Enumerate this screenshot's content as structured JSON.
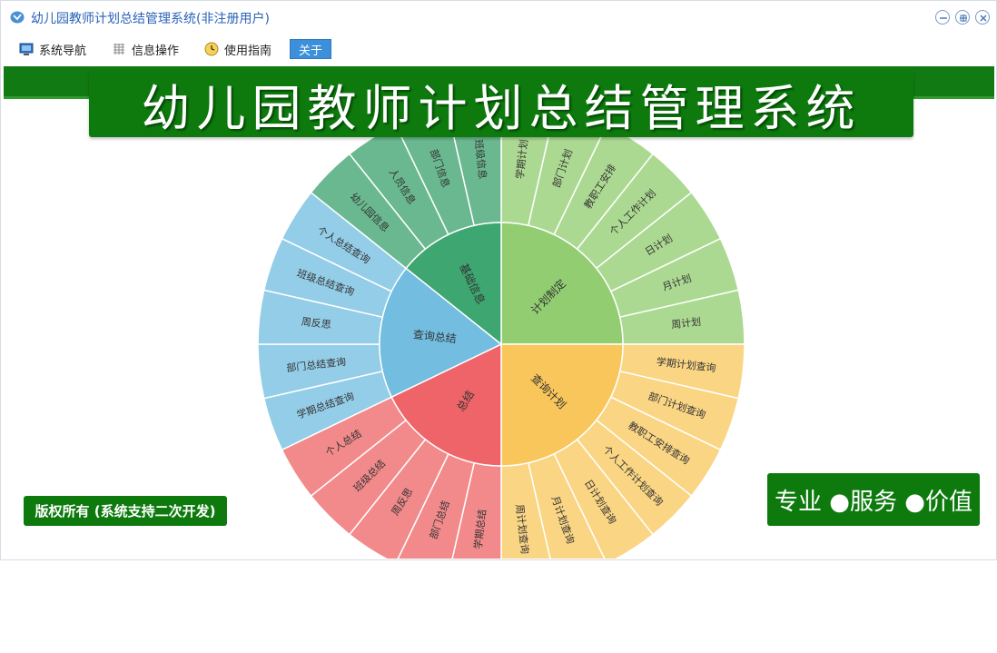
{
  "window": {
    "title": "幼儿园教师计划总结管理系统(非注册用户)",
    "controls": [
      "minimize",
      "restore",
      "close"
    ]
  },
  "menu": [
    {
      "label": "系统导航",
      "icon": "monitor-icon",
      "active": false
    },
    {
      "label": "信息操作",
      "icon": "grid-icon",
      "active": false
    },
    {
      "label": "使用指南",
      "icon": "clock-icon",
      "active": false
    },
    {
      "label": "关于",
      "icon": "",
      "active": true
    }
  ],
  "banner": {
    "title": "幼儿园教师计划总结管理系统"
  },
  "copyright": "版权所有 (系统支持二次开发)",
  "slogan": "专业 ●服务 ●价值",
  "colors": {
    "band_green": "#127a12",
    "banner_green": "#0e7a0e",
    "title_blue": "#2a62b8",
    "active_menu": "#3c8fd9"
  },
  "chart_data": {
    "type": "sunburst",
    "categories": [
      {
        "name": "计划制定",
        "color": "#92cd72",
        "light": "#acd992",
        "children": [
          "学期计划",
          "部门计划",
          "教职工安排",
          "个人工作计划",
          "日计划",
          "月计划",
          "周计划"
        ]
      },
      {
        "name": "查询计划",
        "color": "#f8c65b",
        "light": "#fad584",
        "children": [
          "学期计划查询",
          "部门计划查询",
          "教职工安排查询",
          "个人工作计划查询",
          "日计划查询",
          "月计划查询",
          "周计划查询"
        ]
      },
      {
        "name": "总结",
        "color": "#ee6468",
        "light": "#f28a8b",
        "children": [
          "学期总结",
          "部门总结",
          "周反思",
          "班级总结",
          "个人总结"
        ]
      },
      {
        "name": "查询总结",
        "color": "#73bde0",
        "light": "#94cde7",
        "children": [
          "学期总结查询",
          "部门总结查询",
          "周反思",
          "班级总结查询",
          "个人总结查询"
        ]
      },
      {
        "name": "基础信息",
        "color": "#3da671",
        "light": "#6ab890",
        "children": [
          "幼儿园信息",
          "人员信息",
          "部门信息",
          "班级信息"
        ]
      }
    ]
  }
}
